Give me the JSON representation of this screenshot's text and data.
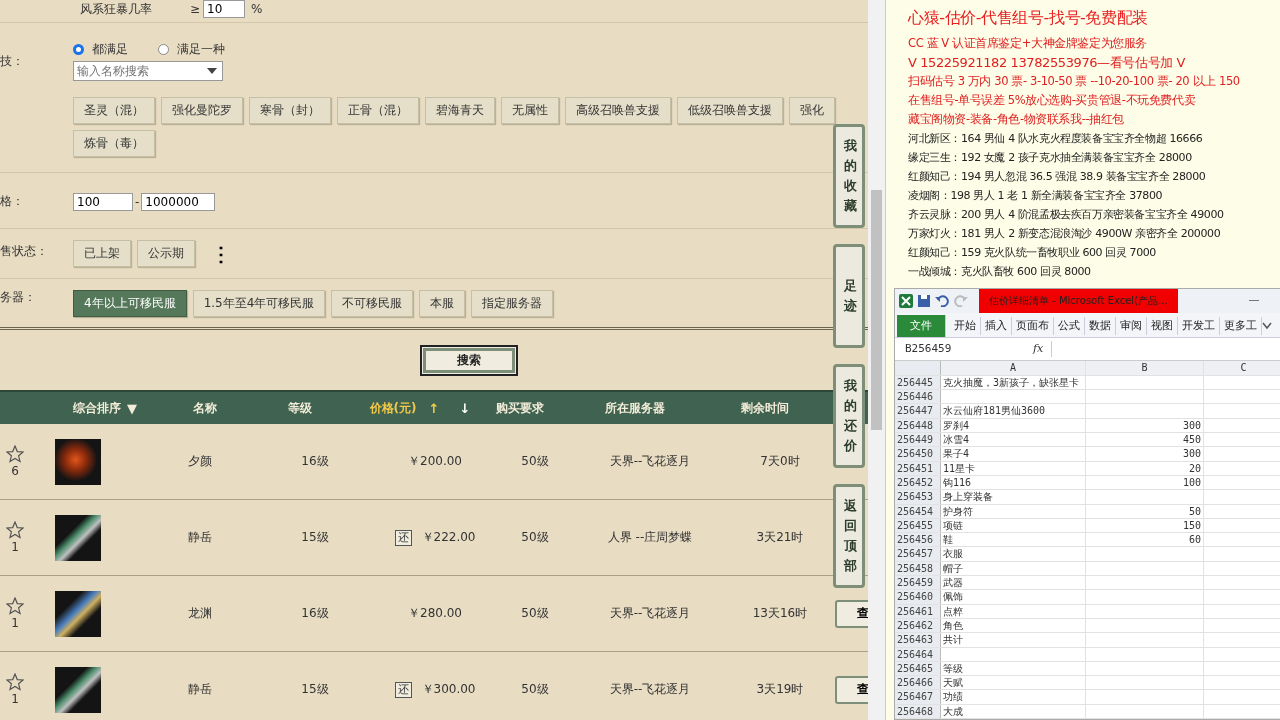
{
  "filters": {
    "rate": {
      "label": "风系狂暴几率",
      "op": "≥",
      "value": "10",
      "unit": "%"
    },
    "skills": {
      "label": "技：",
      "radios": [
        {
          "label": "都满足",
          "selected": true
        },
        {
          "label": "满足一种",
          "selected": false
        }
      ],
      "search": {
        "placeholder": "输入名称搜索"
      },
      "tags": [
        "圣灵（混）",
        "强化曼陀罗",
        "寒骨（封）",
        "正骨（混）",
        "碧海青天",
        "无属性",
        "高级召唤兽支援",
        "低级召唤兽支援",
        "强化",
        "炼骨（毒）"
      ]
    },
    "price": {
      "label": "格：",
      "min": "100",
      "separator": "-",
      "max": "1000000"
    },
    "sale_status": {
      "label": "售状态：",
      "options": [
        {
          "label": "已上架",
          "selected": false
        },
        {
          "label": "公示期",
          "selected": false
        }
      ],
      "more": "⋮"
    },
    "server": {
      "label": "务器：",
      "options": [
        {
          "label": "4年以上可移民服",
          "selected": true
        },
        {
          "label": "1.5年至4年可移民服",
          "selected": false
        },
        {
          "label": "不可移民服",
          "selected": false
        },
        {
          "label": "本服",
          "selected": false
        },
        {
          "label": "指定服务器",
          "selected": false
        }
      ]
    }
  },
  "search_button": "搜索",
  "side_tabs": [
    "我的收藏",
    "足迹",
    "我的还价",
    "返回顶部"
  ],
  "table": {
    "columns": [
      {
        "label": "综合排序",
        "marks": [
          "▼"
        ],
        "highlighted": false
      },
      {
        "label": "名称",
        "highlighted": false
      },
      {
        "label": "等级",
        "highlighted": false
      },
      {
        "label": "价格(元)",
        "marks": [
          "↑",
          "↓"
        ],
        "highlighted": true
      },
      {
        "label": "购买要求",
        "highlighted": false
      },
      {
        "label": "所在服务器",
        "highlighted": false
      },
      {
        "label": "剩余时间",
        "highlighted": false
      }
    ],
    "rows": [
      {
        "favorites": "6",
        "name": "夕颜",
        "level": "16级",
        "bargain": false,
        "bargain_mark": "",
        "price": "￥200.00",
        "requirement": "50级",
        "server": "天界--飞花逐月",
        "time_left": "7天0时",
        "action": ""
      },
      {
        "favorites": "1",
        "name": "静岳",
        "level": "15级",
        "bargain": true,
        "bargain_mark": "还",
        "price": "￥222.00",
        "requirement": "50级",
        "server": "人界 --庄周梦蝶",
        "time_left": "3天21时",
        "action": ""
      },
      {
        "favorites": "1",
        "name": "龙渊",
        "level": "16级",
        "bargain": false,
        "bargain_mark": "",
        "price": "￥280.00",
        "requirement": "50级",
        "server": "天界--飞花逐月",
        "time_left": "13天16时",
        "action": "查"
      },
      {
        "favorites": "1",
        "name": "静岳",
        "level": "15级",
        "bargain": true,
        "bargain_mark": "还",
        "price": "￥300.00",
        "requirement": "50级",
        "server": "天界--飞花逐月",
        "time_left": "3天19时",
        "action": "查"
      }
    ]
  },
  "notes": [
    {
      "kind": "headline",
      "text": "心猿-估价-代售组号-找号-免费配装"
    },
    {
      "kind": "promo",
      "text": "CC 蓝 V 认证首席鉴定+大神金牌鉴定为您服务"
    },
    {
      "kind": "contact",
      "text": "V 15225921182      13782553976—看号估号加 V"
    },
    {
      "kind": "promo",
      "text": "扫码估号 3 万内 30 票- 3-10-50 票  --10-20-100 票- 20 以上 150"
    },
    {
      "kind": "promo",
      "text": "在售组号-单号误差 5%放心选购-买贵管退-不玩免费代卖"
    },
    {
      "kind": "promo",
      "text": "藏宝阁物资-装备-角色-物资联系我--抽红包"
    },
    {
      "kind": "listing",
      "text": "河北新区：164 男仙 4 队水克火程度装备宝宝齐全物超 16666"
    },
    {
      "kind": "listing",
      "text": "缘定三生：192 女魔 2 孩子克水抽全满装备宝宝齐全 28000"
    },
    {
      "kind": "listing",
      "text": "红颜知己：194 男人忽混 36.5 强混 38.9 装备宝宝齐全 28000"
    },
    {
      "kind": "listing",
      "text": "凌烟阁：198 男人 1 老 1 新全满装备宝宝齐全 37800"
    },
    {
      "kind": "listing",
      "text": "齐云灵脉：200 男人 4 阶混孟极去疾百万亲密装备宝宝齐全 49000"
    },
    {
      "kind": "listing",
      "text": "万家灯火：181 男人 2 新变态混浪淘沙 4900W 亲密齐全 200000"
    },
    {
      "kind": "listing",
      "text": "红颜知己：159 克火队统一畜牧职业 600 回灵 7000"
    },
    {
      "kind": "listing",
      "text": "一战倾城：克火队畜牧 600 回灵 8000"
    }
  ],
  "excel": {
    "title": "估价详细清单 - Microsoft Excel(产品...",
    "tabs": [
      {
        "label": "文件",
        "selected": true
      },
      {
        "label": "开始",
        "selected": false
      },
      {
        "label": "插入",
        "selected": false
      },
      {
        "label": "页面布",
        "selected": false
      },
      {
        "label": "公式",
        "selected": false
      },
      {
        "label": "数据",
        "selected": false
      },
      {
        "label": "审阅",
        "selected": false
      },
      {
        "label": "视图",
        "selected": false
      },
      {
        "label": "开发工",
        "selected": false
      },
      {
        "label": "更多工",
        "selected": false
      }
    ],
    "name_box": "B256459",
    "fx": "fx",
    "columns": [
      "A",
      "B",
      "C"
    ],
    "rows": [
      [
        "256445",
        "克火抽魔，3新孩子，缺张星卡",
        ""
      ],
      [
        "256446",
        "",
        ""
      ],
      [
        "256447",
        "水云仙府181男仙3600",
        ""
      ],
      [
        "256448",
        "罗刹4",
        "300"
      ],
      [
        "256449",
        "冰雪4",
        "450"
      ],
      [
        "256450",
        "果子4",
        "300"
      ],
      [
        "256451",
        "11星卡",
        "20"
      ],
      [
        "256452",
        "钩116",
        "100"
      ],
      [
        "256453",
        "身上穿装备",
        ""
      ],
      [
        "256454",
        "护身符",
        "50"
      ],
      [
        "256455",
        "项链",
        "150"
      ],
      [
        "256456",
        "鞋",
        "60"
      ],
      [
        "256457",
        "衣服",
        ""
      ],
      [
        "256458",
        "帽子",
        ""
      ],
      [
        "256459",
        "武器",
        ""
      ],
      [
        "256460",
        "佩饰",
        ""
      ],
      [
        "256461",
        "点粹",
        ""
      ],
      [
        "256462",
        "角色",
        ""
      ],
      [
        "256463",
        "共计",
        ""
      ],
      [
        "256464",
        "",
        ""
      ],
      [
        "256465",
        "等级",
        ""
      ],
      [
        "256466",
        "天赋",
        ""
      ],
      [
        "256467",
        "功绩",
        ""
      ],
      [
        "256468",
        "大成",
        ""
      ]
    ]
  }
}
